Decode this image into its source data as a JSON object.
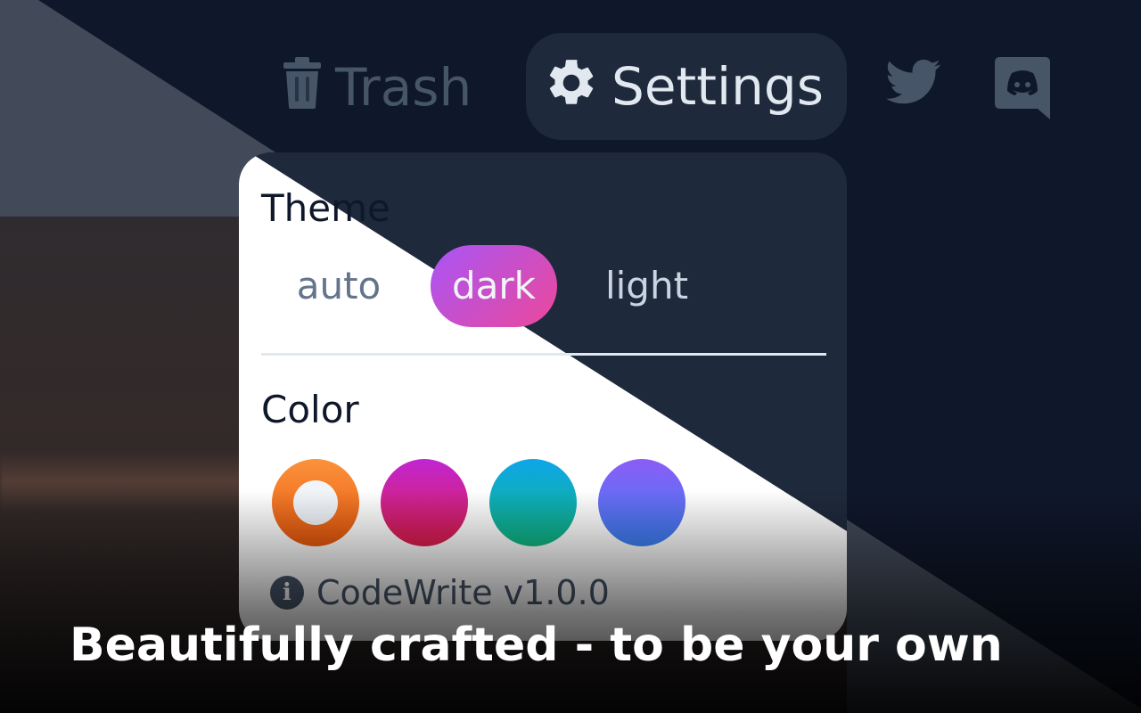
{
  "nav": {
    "trash_label": "Trash",
    "settings_label": "Settings",
    "twitter_icon": "twitter-icon",
    "discord_icon": "discord-icon"
  },
  "settings_panel": {
    "theme_title": "Theme",
    "theme_options": [
      {
        "label": "auto",
        "selected": false
      },
      {
        "label": "dark",
        "selected": true
      },
      {
        "label": "light",
        "selected": false
      }
    ],
    "color_title": "Color",
    "colors": [
      {
        "name": "orange",
        "hex": "#f97316",
        "selected": true
      },
      {
        "name": "pink",
        "hex": "#db2777",
        "selected": false
      },
      {
        "name": "teal",
        "hex": "#14b8a6",
        "selected": false
      },
      {
        "name": "indigo",
        "hex": "#6366f1",
        "selected": false
      }
    ],
    "version_text": "CodeWrite v1.0.0",
    "info_icon_glyph": "i"
  },
  "tagline": "Beautifully crafted - to be your own",
  "colors": {
    "background_dark": "#0f172a",
    "panel_dark": "#1e293b",
    "panel_light": "#ffffff",
    "accent_gradient": [
      "#a855f7",
      "#ec4899"
    ]
  }
}
